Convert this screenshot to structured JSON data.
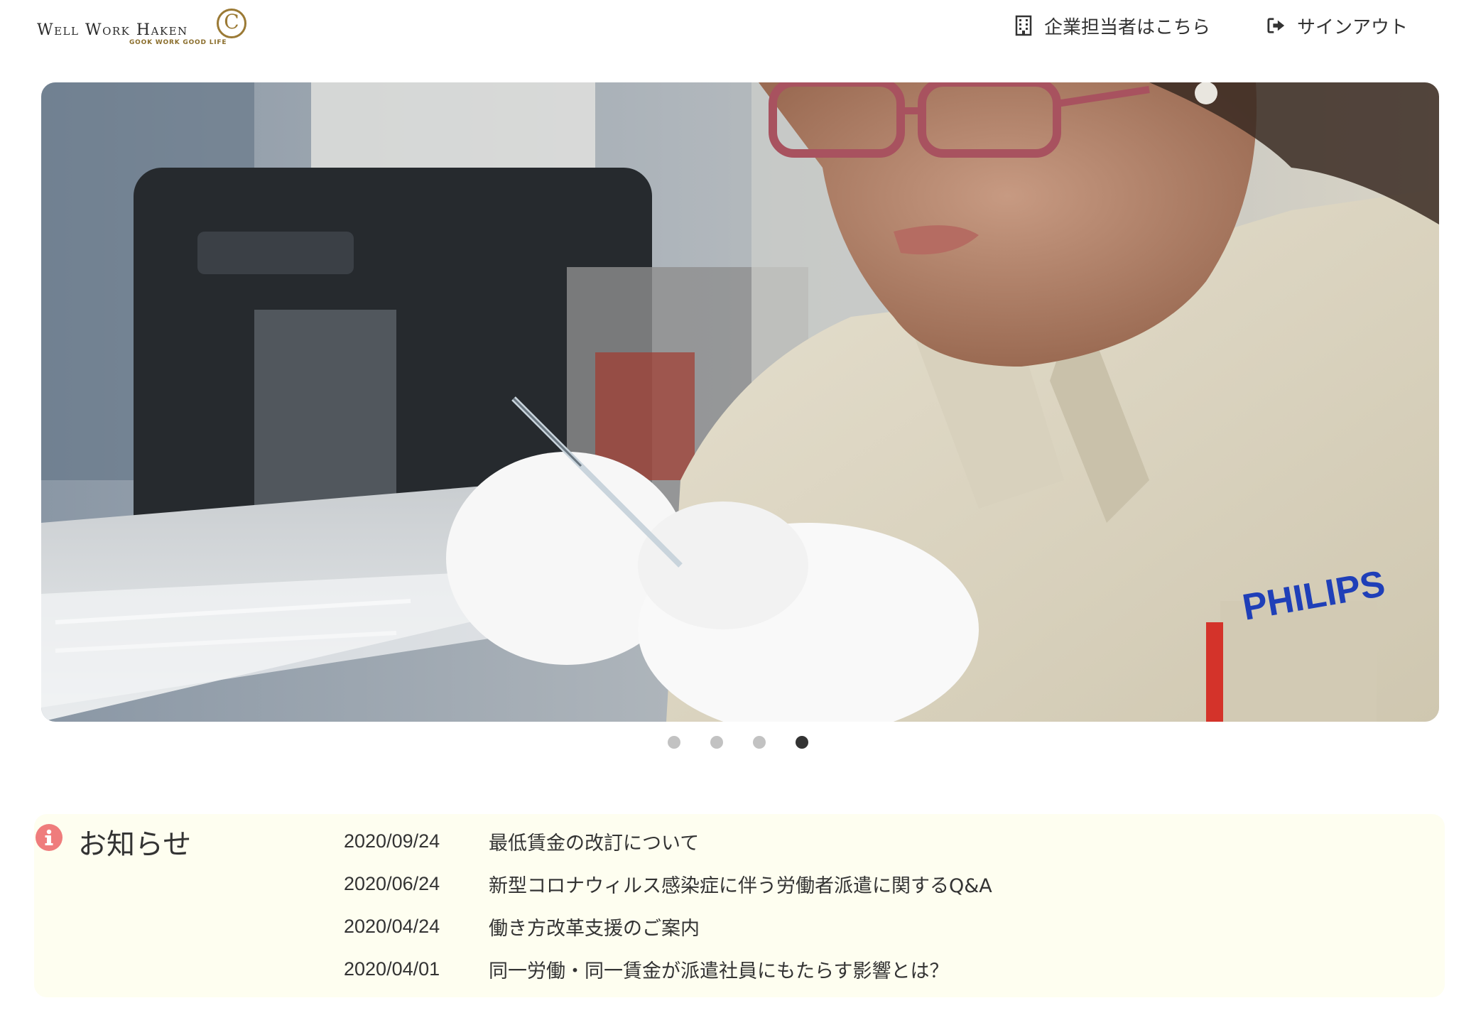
{
  "header": {
    "logo_text": "Well Work Haken",
    "logo_tagline": "GOOK WORK GOOD LIFE",
    "logo_mark": "C",
    "corporate_link": {
      "label": "企業担当者はこちら",
      "icon": "building-icon"
    },
    "signout_link": {
      "label": "サインアウト",
      "icon": "sign-out-icon"
    }
  },
  "carousel": {
    "slide_count": 4,
    "active_index": 3,
    "image_description_icon": "photo-slide",
    "badge_text": "PHILIPS"
  },
  "news": {
    "title": "お知らせ",
    "icon": "info-icon",
    "items": [
      {
        "date": "2020/09/24",
        "title": "最低賃金の改訂について"
      },
      {
        "date": "2020/06/24",
        "title": "新型コロナウィルス感染症に伴う労働者派遣に関するQ&A"
      },
      {
        "date": "2020/04/24",
        "title": "働き方改革支援のご案内"
      },
      {
        "date": "2020/04/01",
        "title": "同一労働・同一賃金が派遣社員にもたらす影響とは？"
      }
    ]
  },
  "colors": {
    "news_background": "#fefef0",
    "info_icon": "#ef7c7c",
    "logo_gold": "#9b7a35",
    "dot_active": "#333333",
    "dot_inactive": "#c2c2c2"
  }
}
